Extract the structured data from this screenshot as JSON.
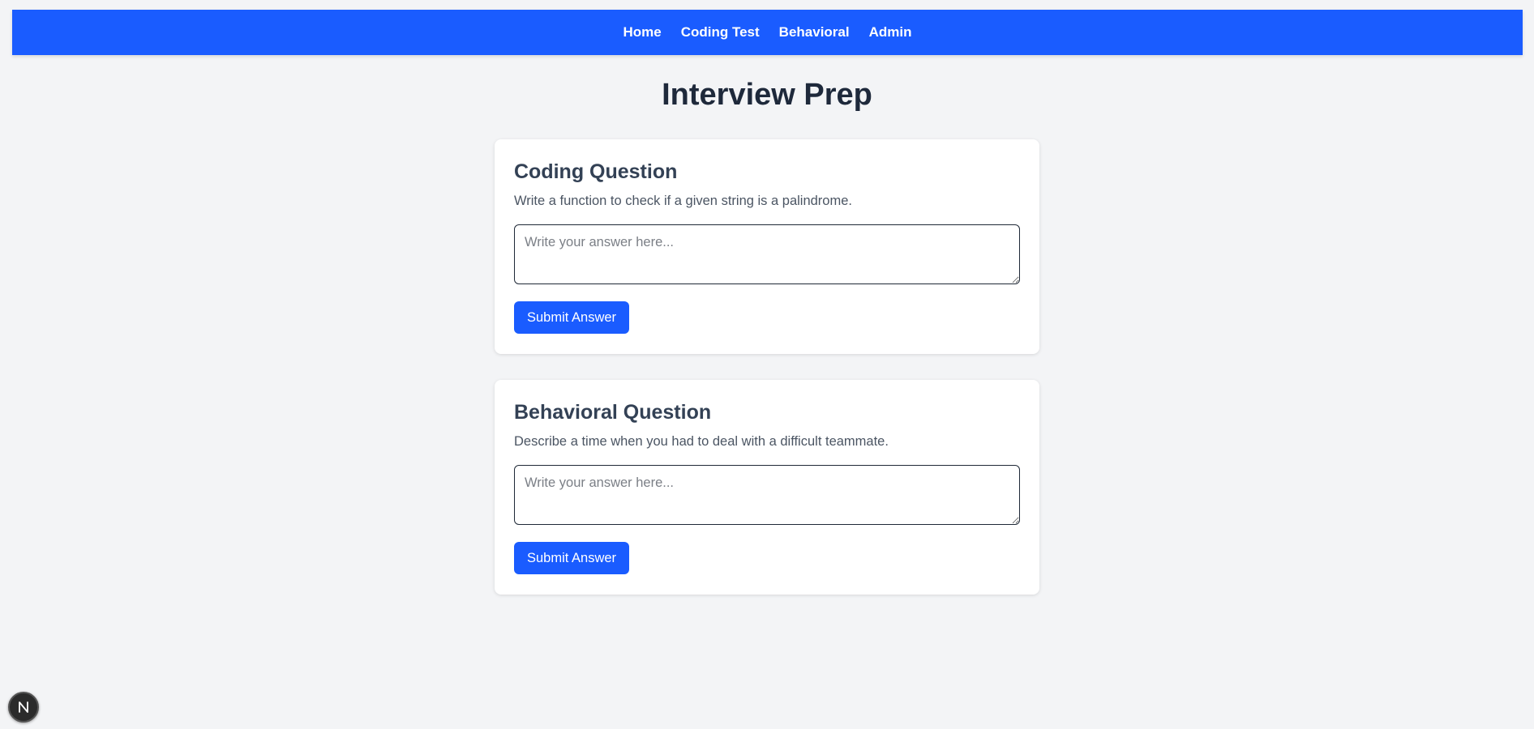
{
  "nav": {
    "items": [
      "Home",
      "Coding Test",
      "Behavioral",
      "Admin"
    ]
  },
  "page": {
    "title": "Interview Prep"
  },
  "cards": [
    {
      "title": "Coding Question",
      "question": "Write a function to check if a given string is a palindrome.",
      "placeholder": "Write your answer here...",
      "value": "",
      "button": "Submit Answer"
    },
    {
      "title": "Behavioral Question",
      "question": "Describe a time when you had to deal with a difficult teammate.",
      "placeholder": "Write your answer here...",
      "value": "",
      "button": "Submit Answer"
    }
  ],
  "badge": {
    "icon": "nextjs-icon"
  },
  "colors": {
    "accent": "#1a5cff",
    "background": "#f3f4f6",
    "card": "#ffffff",
    "title": "#1e293b"
  }
}
